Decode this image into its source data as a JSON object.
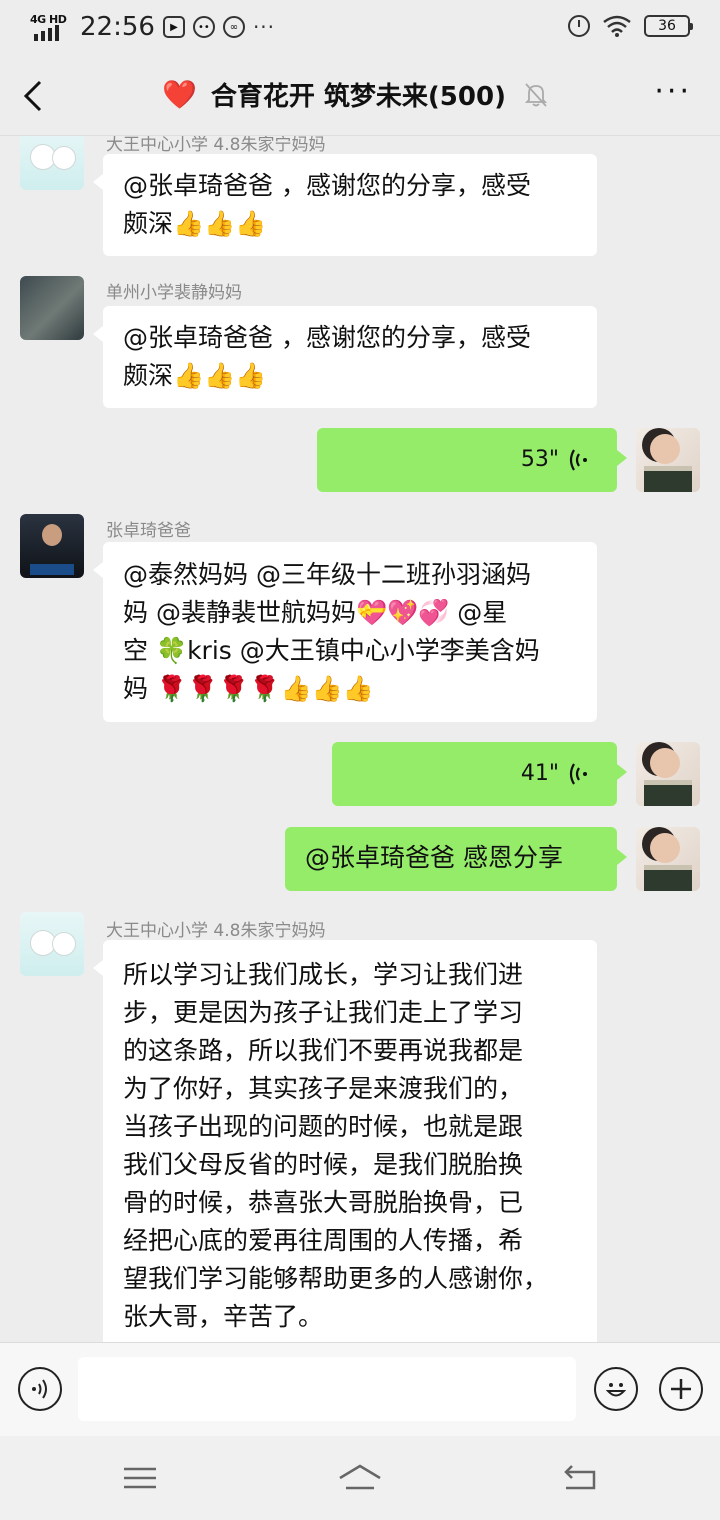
{
  "status_bar": {
    "network_label": "4G HD",
    "time": "22:56",
    "battery": "36",
    "icons": [
      "play-icon",
      "bot-icon",
      "wechat-icon",
      "more-dots-icon",
      "alarm-icon",
      "wifi-icon",
      "battery-icon"
    ]
  },
  "header": {
    "title": "合育花开 筑梦未来(500)",
    "heart_emoji": "❤️",
    "more_label": "···"
  },
  "messages": [
    {
      "side": "left",
      "sender": "大王中心小学 4.8朱家宁妈妈",
      "avatar": "snowman-avatar",
      "lines": [
        "@张卓琦爸爸 ，感谢您的分享，感受",
        "颇深👍👍👍"
      ]
    },
    {
      "side": "left",
      "sender": "单州小学裴静妈妈",
      "avatar": "dark-photo-avatar",
      "lines": [
        "@张卓琦爸爸 ，感谢您的分享，感受",
        "颇深👍👍👍"
      ]
    },
    {
      "side": "right",
      "type": "voice",
      "duration": "53\""
    },
    {
      "side": "left",
      "sender": "张卓琦爸爸",
      "avatar": "man-suit-avatar",
      "lines": [
        "@泰然妈妈 @三年级十二班孙羽涵妈",
        "妈 @裴静裴世航妈妈💝💖💞 @星",
        "空 🍀kris @大王镇中心小学李美含妈",
        "妈 🌹🌹🌹🌹👍👍👍"
      ]
    },
    {
      "side": "right",
      "type": "voice",
      "duration": "41\""
    },
    {
      "side": "right",
      "type": "text",
      "text": "@张卓琦爸爸  感恩分享"
    },
    {
      "side": "left",
      "sender": "大王中心小学 4.8朱家宁妈妈",
      "avatar": "snowman-avatar",
      "lines": [
        "所以学习让我们成长，学习让我们进",
        "步，更是因为孩子让我们走上了学习",
        "的这条路，所以我们不要再说我都是",
        "为了你好，其实孩子是来渡我们的，",
        "当孩子出现的问题的时候，也就是跟",
        "我们父母反省的时候，是我们脱胎换",
        "骨的时候，恭喜张大哥脱胎换骨，已",
        "经把心底的爱再往周围的人传播，希",
        "望我们学习能够帮助更多的人感谢你，",
        "张大哥，辛苦了。"
      ]
    }
  ],
  "input_bar": {
    "placeholder": "",
    "voice_button": "voice-input-icon",
    "emoji_button": "emoji-icon",
    "plus_button": "plus-icon"
  },
  "nav_bar": {
    "buttons": [
      "menu-icon",
      "home-icon",
      "back-nav-icon"
    ]
  },
  "colors": {
    "background": "#ededed",
    "my_bubble": "#95ec69",
    "other_bubble": "#ffffff",
    "sender_name": "#8a8a8a"
  }
}
